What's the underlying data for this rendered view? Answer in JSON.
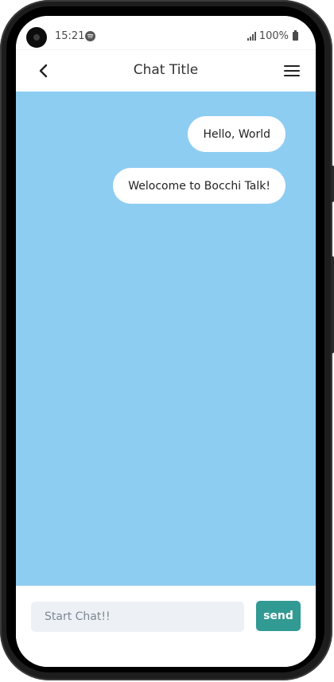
{
  "status_bar": {
    "time": "15:21",
    "music_icon": "spotify-icon",
    "signal_icon": "signal-bars-icon",
    "battery_text": "100%",
    "battery_icon": "battery-icon"
  },
  "header": {
    "back_icon": "chevron-left-icon",
    "title": "Chat Title",
    "menu_icon": "hamburger-menu-icon"
  },
  "chat": {
    "background_color": "#8ecdf2",
    "messages": [
      {
        "text": "Hello, World",
        "side": "right"
      },
      {
        "text": "Welocome to Bocchi Talk!",
        "side": "right"
      }
    ]
  },
  "composer": {
    "input_value": "",
    "input_placeholder": "Start Chat!!",
    "send_label": "send",
    "send_color": "#319a92"
  }
}
